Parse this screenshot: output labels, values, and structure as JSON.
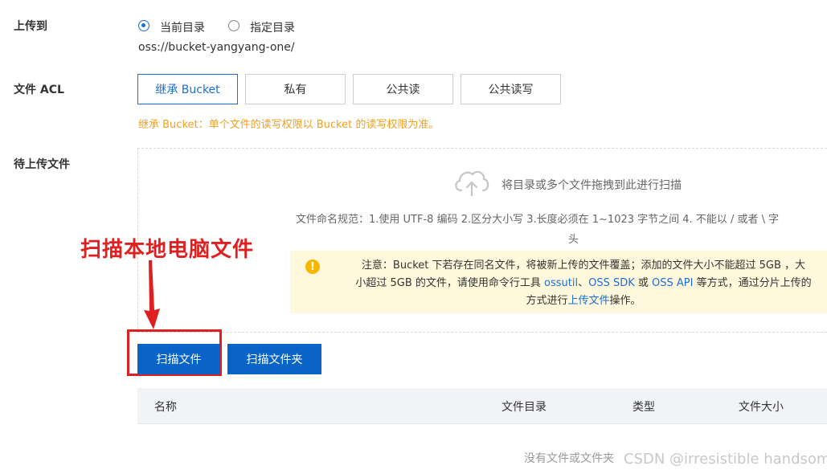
{
  "upload_to": {
    "label": "上传到",
    "options": [
      {
        "label": "当前目录",
        "checked": true
      },
      {
        "label": "指定目录",
        "checked": false
      }
    ],
    "path": "oss://bucket-yangyang-one/"
  },
  "acl": {
    "label": "文件 ACL",
    "options": [
      {
        "label": "继承 Bucket",
        "active": true
      },
      {
        "label": "私有",
        "active": false
      },
      {
        "label": "公共读",
        "active": false
      },
      {
        "label": "公共读写",
        "active": false
      }
    ],
    "hint": "继承 Bucket：单个文件的读写权限以 Bucket 的读写权限为准。"
  },
  "pending": {
    "label": "待上传文件",
    "drop_text": "将目录或多个文件拖拽到此进行扫描",
    "naming_rule_line1": "文件命名规范：1.使用 UTF-8 编码 2.区分大小写 3.长度必须在 1~1023 字节之间 4. 不能以 / 或者 \\ 字",
    "naming_rule_line2": "头",
    "warning": {
      "line1": "注意：Bucket 下若存在同名文件，将被新上传的文件覆盖；添加的文件大小不能超过 5GB ，大",
      "line2_pre": "小超过 5GB 的文件，请使用命令行工具 ",
      "link_ossutil": "ossutil",
      "sep1": "、",
      "link_sdk": "OSS SDK",
      "or": " 或 ",
      "link_api": "OSS API",
      "line2_post": " 等方式，通过分片上传的",
      "line3_pre": "方式进行",
      "link_upload": "上传文件",
      "line3_post": "操作。"
    }
  },
  "buttons": {
    "scan_files": "扫描文件",
    "scan_folder": "扫描文件夹"
  },
  "annotation": {
    "text": "扫描本地电脑文件",
    "color": "#e02020"
  },
  "table": {
    "columns": [
      "名称",
      "文件目录",
      "类型",
      "文件大小"
    ],
    "empty_text": "没有文件或文件夹"
  },
  "watermark": "CSDN @irresistible handsom"
}
